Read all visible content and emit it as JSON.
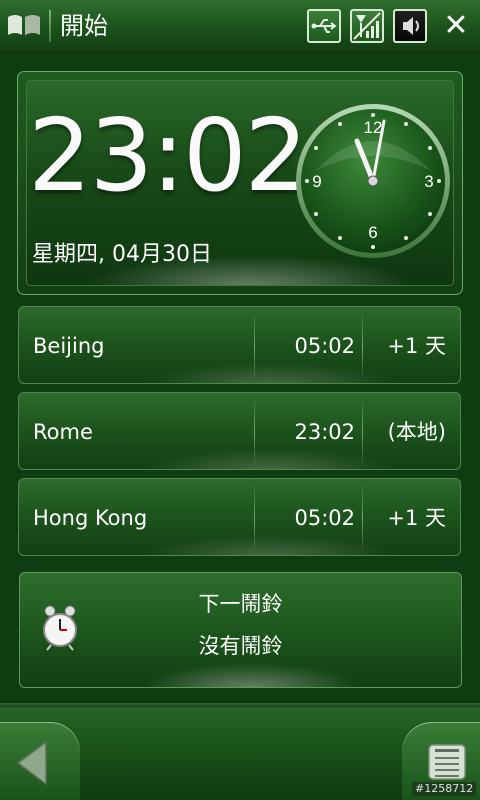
{
  "status_bar": {
    "title": "開始",
    "icons": [
      "windows-logo-icon",
      "usb-icon",
      "signal-icon",
      "speaker-icon",
      "close-icon"
    ],
    "close_glyph": "✕"
  },
  "clock": {
    "time": "23:02",
    "date": "星期四, 04月30日",
    "dial_numbers": {
      "n12": "12",
      "n3": "3",
      "n6": "6",
      "n9": "9"
    }
  },
  "world_clocks": [
    {
      "city": "Beijing",
      "time": "05:02",
      "offset": "+1 天"
    },
    {
      "city": "Rome",
      "time": "23:02",
      "offset": "(本地)"
    },
    {
      "city": "Hong Kong",
      "time": "05:02",
      "offset": "+1 天"
    }
  ],
  "alarm": {
    "label": "下一鬧鈴",
    "status": "沒有鬧鈴",
    "icon": "alarm-clock-icon"
  },
  "bottom_bar": {
    "left_key": "back-arrow-icon",
    "right_key": "menu-icon",
    "watermark": "#1258712"
  },
  "colors": {
    "background": "#0f3d12",
    "panel": "#1c551c",
    "accent_border": "#6ea86b",
    "text": "#ffffff"
  }
}
